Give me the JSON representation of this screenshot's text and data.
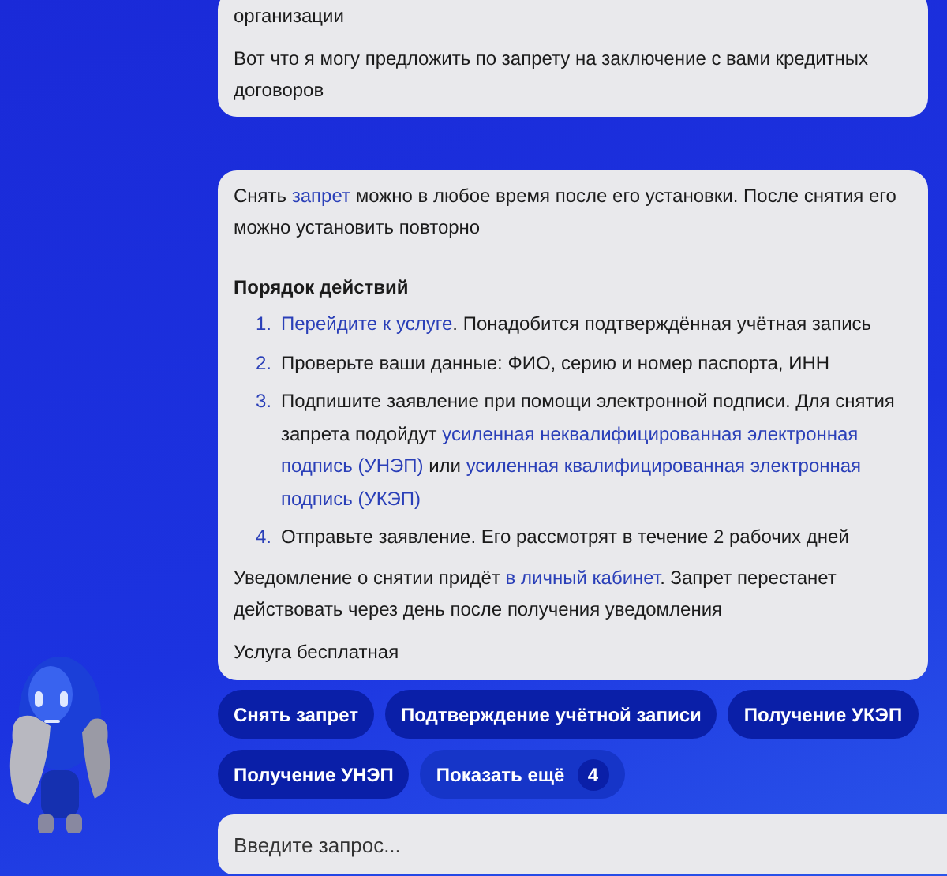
{
  "messages": [
    {
      "paragraphs": [
        [
          {
            "text": "организации",
            "link": false
          }
        ],
        [
          {
            "text": "Вот что я могу предложить по запрету на заключение с вами кредитных договоров",
            "link": false
          }
        ]
      ]
    },
    {
      "intro": [
        {
          "text": "Снять ",
          "link": false
        },
        {
          "text": "запрет",
          "link": true
        },
        {
          "text": " можно в любое время после его установки. После снятия его можно установить повторно",
          "link": false
        }
      ],
      "heading": "Порядок действий",
      "steps": [
        {
          "number": "1.",
          "parts": [
            {
              "text": "Перейдите к услуге",
              "link": true
            },
            {
              "text": ". Понадобится подтверждённая учётная запись",
              "link": false
            }
          ]
        },
        {
          "number": "2.",
          "parts": [
            {
              "text": "Проверьте ваши данные: ФИО, серию и номер паспорта, ИНН",
              "link": false
            }
          ]
        },
        {
          "number": "3.",
          "parts": [
            {
              "text": "Подпишите заявление при помощи электронной подписи. Для снятия запрета подойдут ",
              "link": false
            },
            {
              "text": "усиленная неквалифицированная электронная",
              "link": true
            },
            {
              "text": "подпись (УНЭП)",
              "link": true
            },
            {
              "text": " или ",
              "link": false
            },
            {
              "text": "усиленная квалифицированная электронная",
              "link": true
            },
            {
              "text": "подпись (УКЭП)",
              "link": true
            }
          ]
        },
        {
          "number": "4.",
          "parts": [
            {
              "text": "Отправьте заявление. Его рассмотрят в течение 2 рабочих дней",
              "link": false
            }
          ]
        }
      ],
      "paragraphs": [
        [
          {
            "text": "Уведомление о снятии придёт ",
            "link": false
          },
          {
            "text": "в личный кабинет",
            "link": true
          },
          {
            "text": ". Запрет перестанет действовать через день после получения уведомления",
            "link": false
          }
        ],
        [
          {
            "text": "Услуга бесплатная",
            "link": false
          }
        ]
      ]
    }
  ],
  "suggestions": [
    {
      "label": "Снять запрет"
    },
    {
      "label": "Подтверждение учётной записи"
    },
    {
      "label": "Получение УКЭП"
    },
    {
      "label": "Получение УНЭП"
    },
    {
      "label": "Показать ещё",
      "count": "4"
    }
  ],
  "input": {
    "placeholder": "Введите запрос..."
  }
}
